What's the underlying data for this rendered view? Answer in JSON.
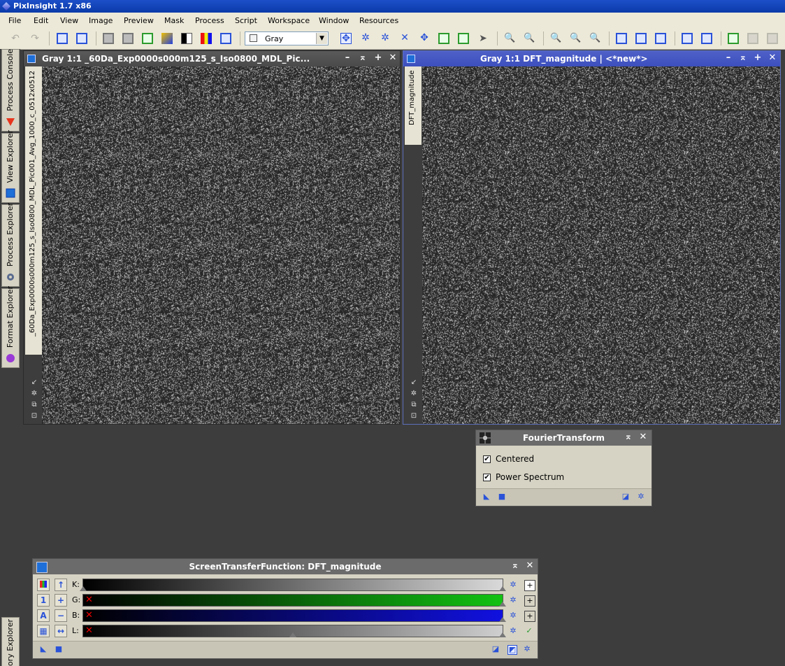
{
  "app": {
    "title": "PixInsight 1.7 x86"
  },
  "menu": [
    "File",
    "Edit",
    "View",
    "Image",
    "Preview",
    "Mask",
    "Process",
    "Script",
    "Workspace",
    "Window",
    "Resources"
  ],
  "toolbar": {
    "display_channel": "Gray"
  },
  "side_tabs": [
    "Process Console",
    "View Explorer",
    "Process Explorer",
    "Format Explorer",
    "History Explorer"
  ],
  "side_tab_bottom_visible": "ory Explorer",
  "windows": {
    "left": {
      "title": "Gray 1:1 _60Da_Exp0000s000m125_s_Iso0800_MDL_Pic...",
      "view_id": "_60Da_Exp0000s000m125_s_Iso0800_MDL_Pic001_Avg_1000_c_0512x0512"
    },
    "right": {
      "title": "Gray 1:1 DFT_magnitude | <*new*>",
      "view_id": "DFT_magnitude"
    }
  },
  "fourier": {
    "title": "FourierTransform",
    "options": [
      {
        "label": "Centered",
        "checked": true
      },
      {
        "label": "Power Spectrum",
        "checked": true
      }
    ]
  },
  "stf": {
    "title": "ScreenTransferFunction: DFT_magnitude",
    "channels": [
      {
        "label": "K:",
        "color": "#d9d9d9",
        "linked": true
      },
      {
        "label": "G:",
        "color": "#12c212",
        "linked": false
      },
      {
        "label": "B:",
        "color": "#1111e0",
        "linked": false
      },
      {
        "label": "L:",
        "color": "#cfcfcf",
        "linked": false
      }
    ],
    "midtones_l": 0.5
  }
}
